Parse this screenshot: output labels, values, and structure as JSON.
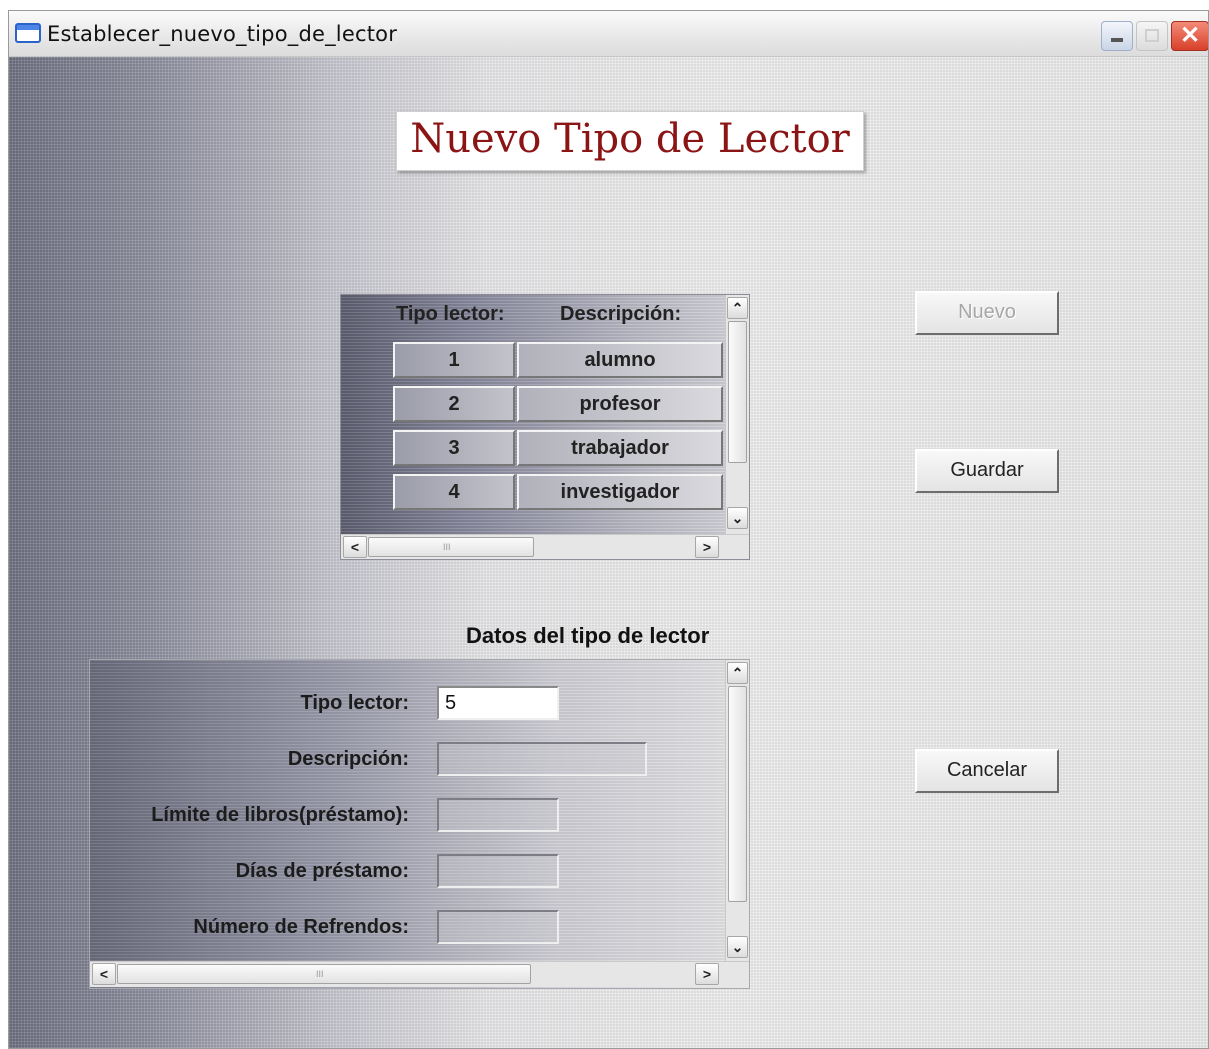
{
  "window": {
    "title": "Establecer_nuevo_tipo_de_lector",
    "controls": {
      "minimize_icon": "minimize-icon",
      "maximize_icon": "maximize-icon",
      "close_label": "✕"
    }
  },
  "heading": "Nuevo Tipo de Lector",
  "grid": {
    "columns": [
      "Tipo lector:",
      "Descripción:"
    ],
    "rows": [
      {
        "tipo": "1",
        "descripcion": "alumno"
      },
      {
        "tipo": "2",
        "descripcion": "profesor"
      },
      {
        "tipo": "3",
        "descripcion": "trabajador"
      },
      {
        "tipo": "4",
        "descripcion": "investigador"
      }
    ]
  },
  "scroll": {
    "up": "⌃",
    "down": "⌄",
    "left": "<",
    "right": ">",
    "grip": "III"
  },
  "buttons": {
    "nuevo": {
      "label": "Nuevo",
      "enabled": false
    },
    "guardar": {
      "label": "Guardar",
      "enabled": true
    },
    "cancelar": {
      "label": "Cancelar",
      "enabled": true
    }
  },
  "form": {
    "section_title": "Datos del tipo de lector",
    "fields": [
      {
        "label": "Tipo lector:",
        "value": "5",
        "enabled": true
      },
      {
        "label": "Descripción:",
        "value": "",
        "enabled": false
      },
      {
        "label": "Límite de libros(préstamo):",
        "value": "",
        "enabled": false
      },
      {
        "label": "Días de préstamo:",
        "value": "",
        "enabled": false
      },
      {
        "label": "Número de Refrendos:",
        "value": "",
        "enabled": false
      }
    ]
  },
  "colors": {
    "heading_text": "#8b1414",
    "close_button": "#d8402a",
    "title_icon": "#2b63c9"
  }
}
